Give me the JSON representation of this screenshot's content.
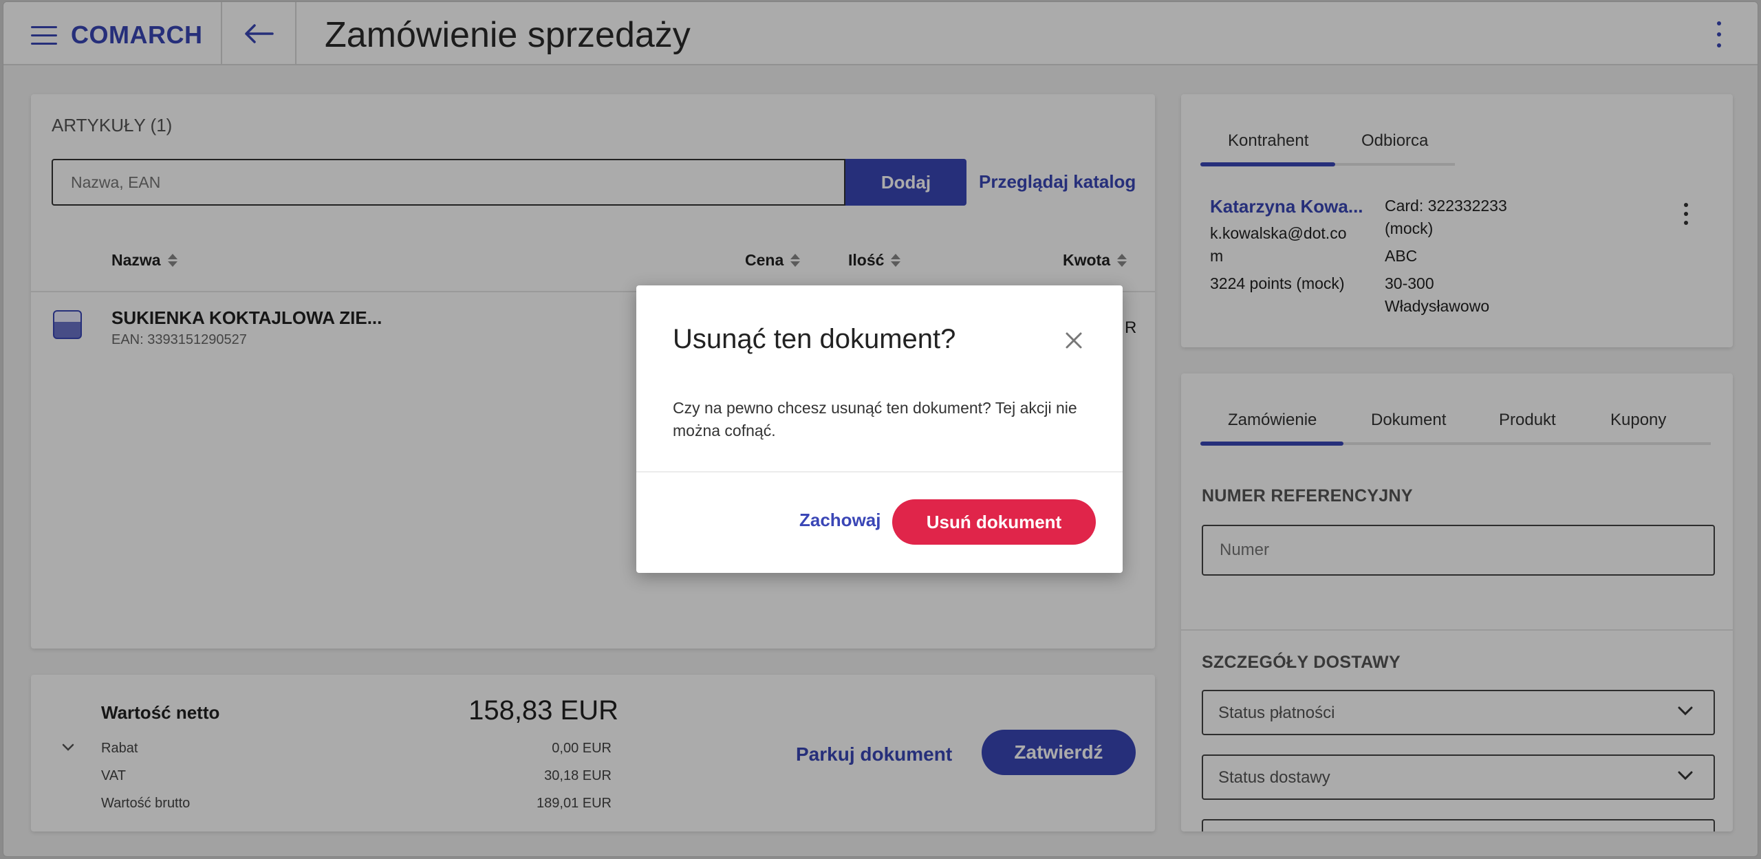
{
  "app": {
    "logo": "COMARCH",
    "title": "Zamówienie sprzedaży"
  },
  "articles": {
    "title": "ARTYKUŁY (1)",
    "search_placeholder": "Nazwa, EAN",
    "add_label": "Dodaj",
    "catalog_link": "Przeglądaj katalog",
    "columns": {
      "name": "Nazwa",
      "price": "Cena",
      "qty": "Ilość",
      "amount": "Kwota"
    },
    "items": [
      {
        "name": "SUKIENKA KOKTAJLOWA ZIE...",
        "ean": "EAN: 3393151290527",
        "amount_fragment": "R"
      }
    ]
  },
  "totals": {
    "net_label": "Wartość netto",
    "net_value": "158,83 EUR",
    "rows": [
      {
        "label": "Rabat",
        "value": "0,00 EUR"
      },
      {
        "label": "VAT",
        "value": "30,18 EUR"
      },
      {
        "label": "Wartość brutto",
        "value": "189,01 EUR"
      }
    ],
    "park_label": "Parkuj dokument",
    "confirm_label": "Zatwierdź"
  },
  "customer": {
    "tabs": [
      "Kontrahent",
      "Odbiorca"
    ],
    "name": "Katarzyna Kowa...",
    "email_line1": "k.kowalska@dot.co",
    "email_line2": "m",
    "points": "3224 points (mock)",
    "card_line1": "Card: 322332233",
    "card_line2": "(mock)",
    "company": "ABC",
    "postal": "30-300",
    "city": "Władysławowo"
  },
  "order": {
    "tabs": [
      "Zamówienie",
      "Dokument",
      "Produkt",
      "Kupony"
    ],
    "ref_title": "NUMER REFERENCYJNY",
    "ref_placeholder": "Numer",
    "delivery_title": "SZCZEGÓŁY DOSTAWY",
    "payment_status": "Status płatności",
    "delivery_status": "Status dostawy"
  },
  "dialog": {
    "title": "Usunąć ten dokument?",
    "message": "Czy na pewno chcesz usunąć ten dokument? Tej akcji nie można cofnąć.",
    "keep_label": "Zachowaj",
    "delete_label": "Usuń dokument"
  },
  "colors": {
    "accent": "#3a46b6",
    "danger": "#e0254a"
  }
}
